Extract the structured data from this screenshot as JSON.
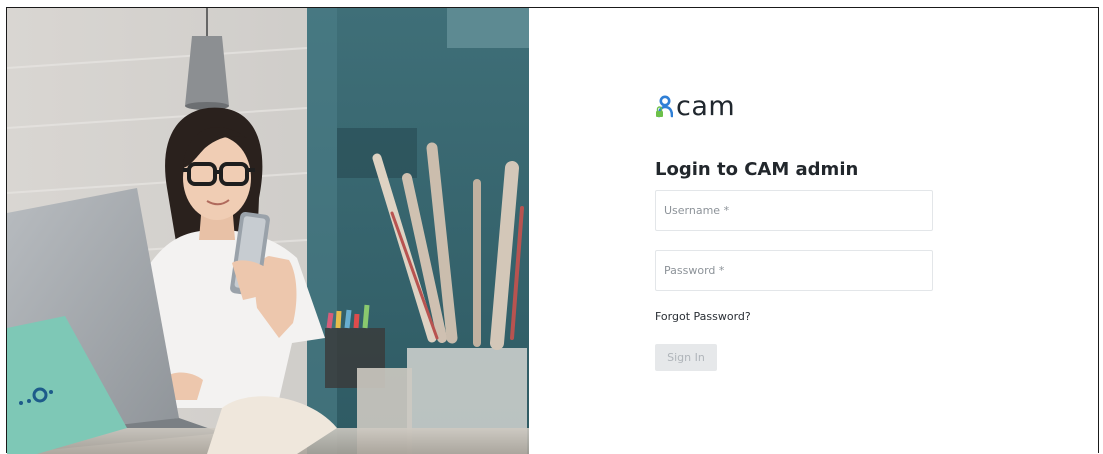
{
  "brand": {
    "name": "cam",
    "icon": "user-lock-icon"
  },
  "login": {
    "title": "Login to CAM admin",
    "username_placeholder": "Username *",
    "username_value": "",
    "password_placeholder": "Password *",
    "password_value": "",
    "forgot_label": "Forgot Password?",
    "signin_label": "Sign In"
  },
  "colors": {
    "brand_blue": "#2f7fd6",
    "brand_green": "#6cc04a",
    "signin_disabled_bg": "#e6e8ea",
    "signin_disabled_text": "#b0b5ba"
  }
}
